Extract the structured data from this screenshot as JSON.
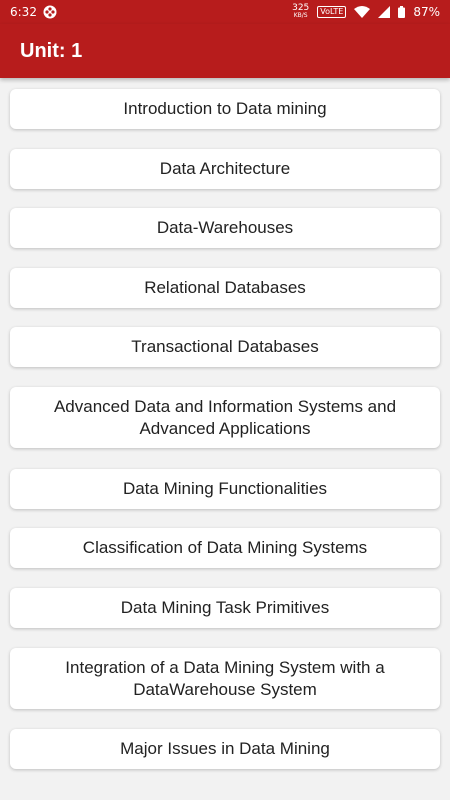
{
  "status_bar": {
    "time": "6:32",
    "net_speed_value": "325",
    "net_speed_unit": "KB/S",
    "volte": "VoLTE",
    "battery": "87%"
  },
  "app_bar": {
    "title": "Unit: 1"
  },
  "topics": [
    "Introduction to Data mining",
    "Data Architecture",
    "Data-Warehouses",
    "Relational Databases",
    "Transactional Databases",
    "Advanced Data and Information Systems and Advanced Applications",
    "Data Mining Functionalities",
    "Classification of Data Mining Systems",
    "Data Mining Task Primitives",
    "Integration of a Data Mining System with a DataWarehouse System",
    "Major Issues in Data Mining"
  ],
  "colors": {
    "primary": "#b71c1c",
    "background": "#f2f2f2",
    "card": "#ffffff",
    "text": "#222222"
  }
}
